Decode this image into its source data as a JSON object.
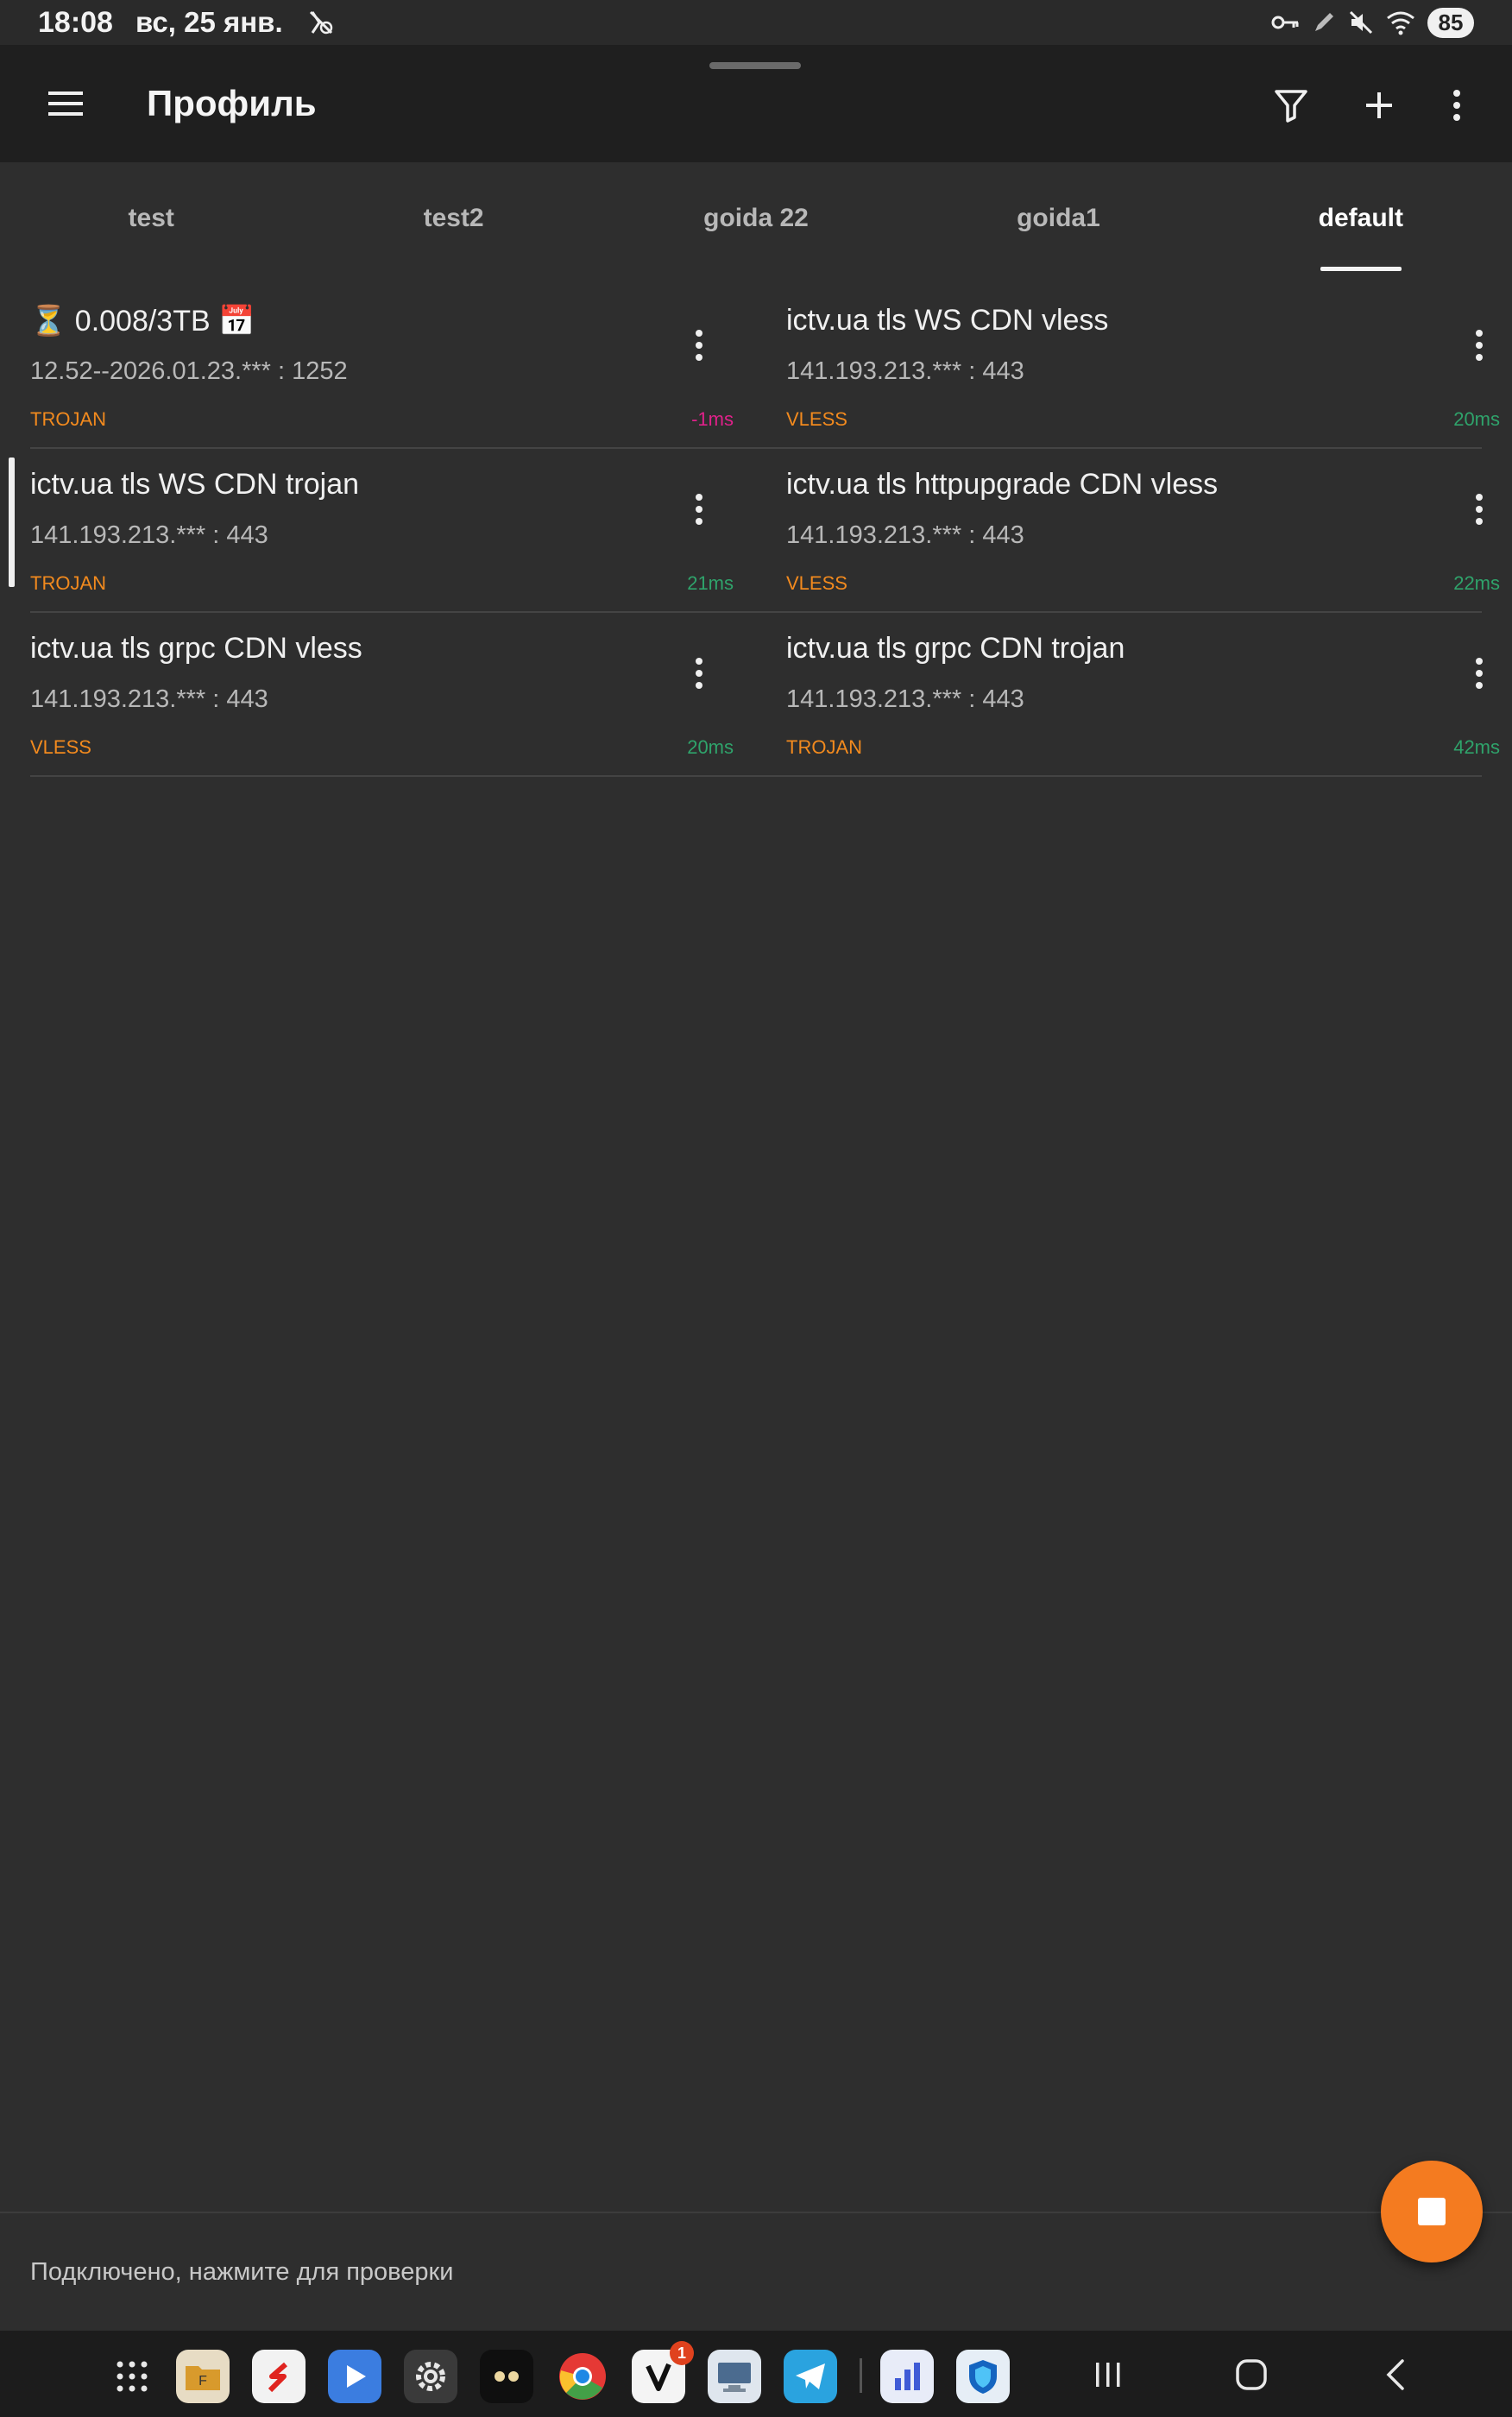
{
  "status_bar": {
    "time": "18:08",
    "date": "вс, 25 янв.",
    "battery": "85"
  },
  "app_bar": {
    "title": "Профиль"
  },
  "tabs": [
    {
      "label": "test",
      "active": false
    },
    {
      "label": "test2",
      "active": false
    },
    {
      "label": "goida 22",
      "active": false
    },
    {
      "label": "goida1",
      "active": false
    },
    {
      "label": "default",
      "active": true
    }
  ],
  "servers": [
    {
      "title": "⏳ 0.008/3TB 📅",
      "address": "12.52--2026.01.23.*** : 1252",
      "protocol": "TROJAN",
      "ping": "-1ms"
    },
    {
      "title": "ictv.ua tls WS CDN vless",
      "address": "141.193.213.*** : 443",
      "protocol": "VLESS",
      "ping": "20ms"
    },
    {
      "title": "ictv.ua tls WS CDN trojan",
      "address": "141.193.213.*** : 443",
      "protocol": "TROJAN",
      "ping": "21ms"
    },
    {
      "title": "ictv.ua tls httpupgrade CDN vless",
      "address": "141.193.213.*** : 443",
      "protocol": "VLESS",
      "ping": "22ms"
    },
    {
      "title": "ictv.ua tls grpc CDN vless",
      "address": "141.193.213.*** : 443",
      "protocol": "VLESS",
      "ping": "20ms"
    },
    {
      "title": "ictv.ua tls grpc CDN trojan",
      "address": "141.193.213.*** : 443",
      "protocol": "TROJAN",
      "ping": "42ms"
    }
  ],
  "bottom": {
    "status_text": "Подключено, нажмите для проверки"
  },
  "dock": {
    "badge_count": "1"
  },
  "colors": {
    "accent": "#f47b20",
    "protocol": "#f28a1e",
    "ping_good": "#2fa36b",
    "ping_bad": "#e0218a"
  }
}
